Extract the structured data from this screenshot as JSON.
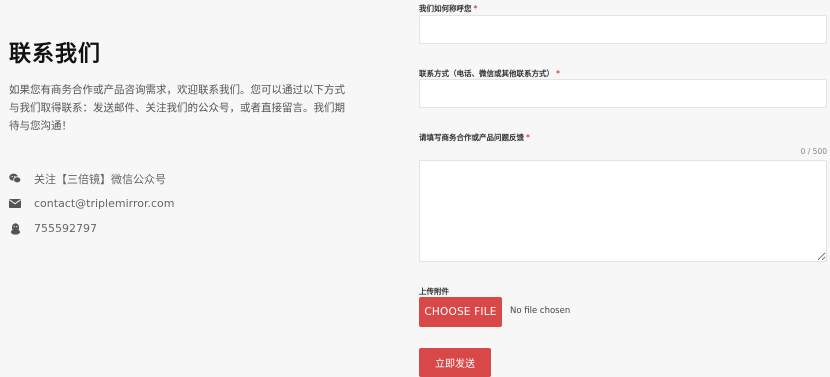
{
  "contact": {
    "title": "联系我们",
    "intro": "如果您有商务合作或产品咨询需求，欢迎联系我们。您可以通过以下方式与我们取得联系：发送邮件、关注我们的公众号，或者直接留言。我们期待与您沟通！",
    "items": [
      {
        "icon": "wechat-icon",
        "text": "关注【三倍镜】微信公众号"
      },
      {
        "icon": "envelope-icon",
        "text": "contact@triplemirror.com"
      },
      {
        "icon": "qq-icon",
        "text": "755592797"
      }
    ]
  },
  "form": {
    "name_label": "我们如何称呼您",
    "name_value": "",
    "method_label": "联系方式（电话、微信或其他联系方式）",
    "method_value": "",
    "message_label": "请填写商务合作或产品问题反馈",
    "message_value": "",
    "counter": "0 / 500",
    "required_mark": "*",
    "attachment_label": "上传附件",
    "choose_file_label": "CHOOSE FILE",
    "file_status": "No file chosen",
    "submit_label": "立即发送"
  },
  "colors": {
    "accent": "#d94848",
    "background": "#f7f7f7",
    "title": "#111111"
  }
}
